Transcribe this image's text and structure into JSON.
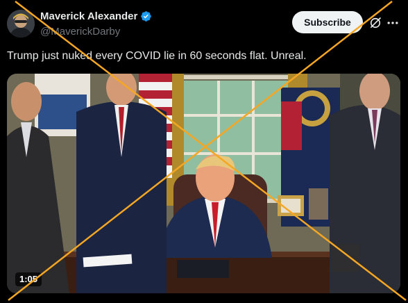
{
  "post": {
    "author_name": "Maverick Alexander",
    "author_handle": "@MaverickDarby",
    "subscribe_label": "Subscribe",
    "text": "Trump just nuked every COVID lie in 60 seconds flat. Unreal.",
    "video_duration": "1:05"
  },
  "icons": {
    "verified": "verified-badge-icon",
    "grok": "grok-icon",
    "more": "more-options-icon"
  },
  "colors": {
    "verified_blue": "#1d9bf0",
    "subscribe_bg": "#eff3f4",
    "cross_orange": "#f5a623",
    "handle_gray": "#71767b"
  }
}
